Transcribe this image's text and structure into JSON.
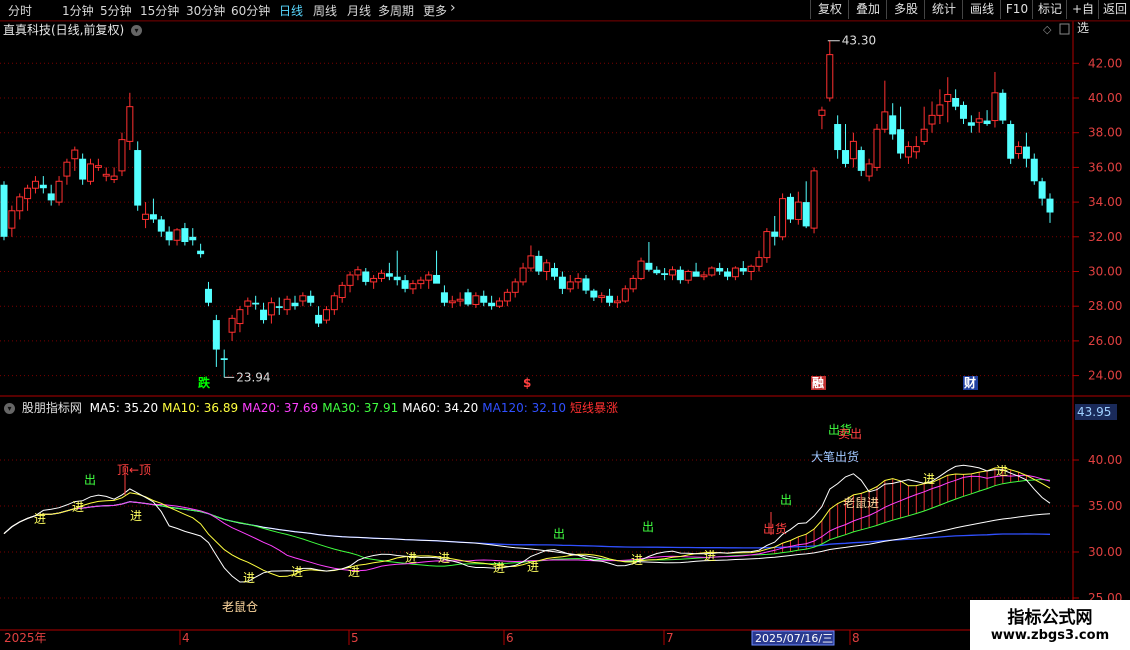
{
  "topbar": {
    "periods": [
      "分时",
      "1分钟",
      "5分钟",
      "15分钟",
      "30分钟",
      "60分钟",
      "日线",
      "周线",
      "月线",
      "多周期",
      "更多"
    ],
    "selected_period": "日线",
    "more_icon": "chevron-right-icon",
    "right_buttons": [
      "复权",
      "叠加",
      "多股",
      "统计",
      "画线",
      "F10",
      "标记",
      "+自选",
      "返回"
    ]
  },
  "chart_title": "直真科技(日线,前复权)",
  "main_chart": {
    "y_ticks": [
      "42.00",
      "40.00",
      "38.00",
      "36.00",
      "34.00",
      "32.00",
      "30.00",
      "28.00",
      "26.00",
      "24.00"
    ],
    "high_label": "43.30",
    "low_label": "23.94",
    "markers": [
      {
        "text": "跌",
        "color": "#00ff00"
      },
      {
        "text": "$",
        "color": "#ff4040"
      },
      {
        "text": "融",
        "color": "#ffffff",
        "bg": "#c03030"
      },
      {
        "text": "财",
        "color": "#ffffff",
        "bg": "#2040a0"
      }
    ]
  },
  "indicator": {
    "name": "股朋指标网",
    "ma": [
      {
        "label": "MA5: 35.20",
        "color": "#ffffff"
      },
      {
        "label": "MA10: 36.89",
        "color": "#ffff40"
      },
      {
        "label": "MA20: 37.69",
        "color": "#ff40ff"
      },
      {
        "label": "MA30: 37.91",
        "color": "#40ff40"
      },
      {
        "label": "MA60: 34.20",
        "color": "#ffffff"
      },
      {
        "label": "MA120: 32.10",
        "color": "#3050ff"
      },
      {
        "label": "短线暴涨",
        "color": "#ff3030"
      }
    ],
    "current_value": "43.95",
    "y_ticks": [
      "40.00",
      "35.00",
      "30.00",
      "25.00"
    ],
    "annotations": {
      "jin": "进",
      "chu": "出",
      "ding": "顶←顶",
      "laoshucang": "老鼠仓",
      "dabi": "大笔出货",
      "laoshujin": "老鼠进",
      "chuhuo": "出货",
      "maichu": "卖出"
    }
  },
  "timeline": {
    "labels": [
      "2025年",
      "4",
      "5",
      "6",
      "7",
      "8"
    ],
    "cursor_date": "2025/07/16/三"
  },
  "watermark": {
    "line1": "指标公式网",
    "line2": "www.zbgs3.com"
  },
  "chart_data": {
    "type": "candlestick",
    "title": "直真科技(日线,前复权)",
    "ylim": [
      23,
      43.5
    ],
    "x_labels": [
      "2025年",
      "4",
      "5",
      "6",
      "7",
      "8"
    ],
    "candles": [
      [
        35.0,
        35.2,
        31.8,
        32.0
      ],
      [
        32.5,
        33.8,
        32.0,
        33.5
      ],
      [
        33.5,
        34.5,
        33.0,
        34.3
      ],
      [
        34.2,
        35.0,
        33.5,
        34.8
      ],
      [
        34.8,
        35.5,
        34.5,
        35.2
      ],
      [
        35.0,
        35.5,
        34.5,
        34.8
      ],
      [
        34.5,
        35.0,
        33.8,
        34.1
      ],
      [
        34.0,
        35.5,
        33.8,
        35.2
      ],
      [
        35.5,
        36.5,
        35.0,
        36.3
      ],
      [
        36.5,
        37.2,
        35.8,
        37.0
      ],
      [
        36.5,
        36.8,
        35.0,
        35.3
      ],
      [
        35.2,
        36.5,
        35.0,
        36.2
      ],
      [
        36.0,
        36.5,
        35.8,
        36.1
      ],
      [
        35.5,
        36.0,
        35.2,
        35.6
      ],
      [
        35.3,
        36.0,
        35.1,
        35.5
      ],
      [
        35.8,
        38.0,
        35.5,
        37.6
      ],
      [
        37.5,
        40.3,
        37.0,
        39.5
      ],
      [
        37.0,
        37.5,
        33.5,
        33.8
      ],
      [
        33.0,
        34.0,
        32.5,
        33.3
      ],
      [
        33.3,
        34.2,
        32.8,
        33.0
      ],
      [
        33.0,
        33.2,
        32.0,
        32.3
      ],
      [
        32.3,
        32.6,
        31.5,
        31.8
      ],
      [
        31.8,
        32.5,
        31.5,
        32.4
      ],
      [
        32.5,
        32.8,
        31.5,
        31.7
      ],
      [
        32.0,
        32.5,
        31.5,
        31.8
      ],
      [
        31.2,
        31.6,
        30.8,
        31.0
      ],
      [
        29.0,
        29.4,
        28.0,
        28.2
      ],
      [
        27.2,
        27.5,
        24.5,
        25.5
      ],
      [
        25.0,
        25.5,
        23.9,
        24.9
      ],
      [
        26.5,
        27.5,
        26.0,
        27.3
      ],
      [
        27.0,
        28.0,
        26.5,
        27.8
      ],
      [
        28.0,
        28.5,
        27.5,
        28.3
      ],
      [
        28.2,
        28.6,
        27.8,
        28.1
      ],
      [
        27.8,
        28.2,
        27.0,
        27.2
      ],
      [
        27.5,
        28.5,
        27.0,
        28.2
      ],
      [
        28.0,
        28.5,
        27.5,
        27.9
      ],
      [
        27.8,
        28.6,
        27.5,
        28.4
      ],
      [
        28.2,
        28.6,
        27.8,
        28.0
      ],
      [
        28.3,
        28.8,
        28.0,
        28.6
      ],
      [
        28.6,
        28.9,
        28.0,
        28.2
      ],
      [
        27.5,
        28.0,
        26.8,
        27.0
      ],
      [
        27.2,
        28.0,
        27.0,
        27.8
      ],
      [
        27.8,
        28.8,
        27.5,
        28.6
      ],
      [
        28.5,
        29.4,
        28.2,
        29.2
      ],
      [
        29.2,
        30.0,
        28.8,
        29.8
      ],
      [
        29.8,
        30.3,
        29.5,
        30.1
      ],
      [
        30.0,
        30.2,
        29.2,
        29.4
      ],
      [
        29.4,
        29.8,
        29.0,
        29.6
      ],
      [
        29.6,
        30.1,
        29.4,
        29.9
      ],
      [
        29.9,
        30.5,
        29.5,
        29.7
      ],
      [
        29.7,
        31.2,
        29.2,
        29.5
      ],
      [
        29.5,
        29.8,
        28.8,
        29.0
      ],
      [
        29.0,
        29.5,
        28.7,
        29.3
      ],
      [
        29.3,
        29.7,
        29.0,
        29.5
      ],
      [
        29.5,
        30.0,
        29.0,
        29.8
      ],
      [
        29.8,
        31.2,
        29.5,
        29.3
      ],
      [
        28.8,
        29.2,
        28.0,
        28.2
      ],
      [
        28.2,
        28.6,
        27.9,
        28.3
      ],
      [
        28.3,
        28.8,
        28.0,
        28.4
      ],
      [
        28.8,
        29.0,
        28.0,
        28.1
      ],
      [
        28.1,
        28.8,
        27.9,
        28.6
      ],
      [
        28.6,
        28.9,
        28.0,
        28.2
      ],
      [
        28.2,
        28.6,
        27.8,
        28.0
      ],
      [
        28.0,
        28.5,
        27.9,
        28.3
      ],
      [
        28.3,
        29.0,
        28.0,
        28.8
      ],
      [
        28.8,
        29.6,
        28.5,
        29.4
      ],
      [
        29.4,
        30.5,
        29.2,
        30.2
      ],
      [
        30.2,
        31.5,
        30.0,
        30.9
      ],
      [
        30.9,
        31.2,
        29.8,
        30.0
      ],
      [
        30.0,
        30.7,
        29.5,
        30.5
      ],
      [
        30.2,
        30.5,
        29.5,
        29.7
      ],
      [
        29.7,
        30.0,
        28.7,
        29.0
      ],
      [
        29.0,
        29.8,
        28.8,
        29.4
      ],
      [
        29.4,
        29.9,
        29.0,
        29.6
      ],
      [
        29.6,
        29.8,
        28.7,
        28.9
      ],
      [
        28.9,
        29.0,
        28.3,
        28.5
      ],
      [
        28.5,
        28.8,
        28.2,
        28.6
      ],
      [
        28.6,
        29.0,
        28.0,
        28.2
      ],
      [
        28.2,
        28.6,
        27.9,
        28.3
      ],
      [
        28.3,
        29.2,
        28.2,
        29.0
      ],
      [
        29.0,
        29.8,
        28.8,
        29.6
      ],
      [
        29.6,
        30.8,
        29.5,
        30.6
      ],
      [
        30.5,
        31.7,
        30.0,
        30.1
      ],
      [
        30.1,
        30.3,
        29.8,
        29.9
      ],
      [
        29.9,
        30.2,
        29.5,
        29.8
      ],
      [
        29.8,
        30.3,
        29.5,
        30.1
      ],
      [
        30.1,
        30.3,
        29.3,
        29.5
      ],
      [
        29.5,
        30.1,
        29.3,
        30.0
      ],
      [
        30.0,
        30.5,
        29.8,
        29.7
      ],
      [
        29.7,
        30.0,
        29.5,
        29.8
      ],
      [
        29.8,
        30.3,
        29.7,
        30.2
      ],
      [
        30.2,
        30.5,
        29.8,
        30.0
      ],
      [
        30.0,
        30.2,
        29.5,
        29.7
      ],
      [
        29.7,
        30.3,
        29.5,
        30.2
      ],
      [
        30.2,
        30.6,
        29.8,
        30.0
      ],
      [
        30.0,
        30.4,
        29.5,
        30.3
      ],
      [
        30.3,
        31.2,
        30.0,
        30.8
      ],
      [
        30.8,
        32.5,
        30.5,
        32.3
      ],
      [
        32.3,
        33.2,
        31.5,
        32.0
      ],
      [
        32.0,
        34.5,
        31.8,
        34.2
      ],
      [
        34.3,
        34.5,
        32.8,
        33.0
      ],
      [
        33.0,
        34.6,
        32.7,
        34.0
      ],
      [
        34.0,
        35.2,
        32.5,
        32.6
      ],
      [
        32.5,
        36.0,
        32.2,
        35.8
      ],
      [
        39.0,
        39.5,
        38.2,
        39.3
      ],
      [
        40.0,
        43.3,
        39.8,
        42.5
      ],
      [
        38.5,
        39.0,
        36.5,
        37.0
      ],
      [
        37.0,
        38.5,
        36.0,
        36.2
      ],
      [
        36.5,
        38.0,
        36.0,
        37.5
      ],
      [
        37.0,
        37.2,
        35.5,
        35.8
      ],
      [
        35.5,
        36.5,
        35.2,
        36.2
      ],
      [
        36.0,
        38.5,
        35.8,
        38.2
      ],
      [
        38.2,
        41.0,
        38.0,
        39.2
      ],
      [
        39.0,
        39.7,
        37.6,
        37.9
      ],
      [
        38.2,
        39.5,
        36.5,
        36.8
      ],
      [
        36.6,
        37.5,
        36.2,
        37.2
      ],
      [
        36.9,
        37.8,
        36.5,
        37.2
      ],
      [
        37.5,
        39.5,
        37.3,
        38.2
      ],
      [
        38.5,
        39.8,
        38.0,
        39.0
      ],
      [
        39.0,
        40.5,
        38.5,
        39.6
      ],
      [
        39.8,
        41.2,
        38.6,
        40.2
      ],
      [
        40.0,
        40.5,
        39.3,
        39.5
      ],
      [
        39.6,
        39.8,
        38.5,
        38.8
      ],
      [
        38.6,
        39.0,
        38.0,
        38.4
      ],
      [
        38.6,
        39.2,
        38.0,
        38.8
      ],
      [
        38.7,
        39.3,
        38.4,
        38.5
      ],
      [
        38.7,
        41.5,
        38.3,
        40.3
      ],
      [
        40.3,
        40.5,
        38.5,
        38.7
      ],
      [
        38.5,
        38.7,
        36.2,
        36.5
      ],
      [
        36.8,
        37.5,
        36.5,
        37.2
      ],
      [
        37.2,
        38.0,
        36.0,
        36.5
      ],
      [
        36.5,
        36.8,
        35.0,
        35.2
      ],
      [
        35.2,
        35.4,
        33.8,
        34.2
      ],
      [
        34.2,
        34.5,
        32.8,
        33.4
      ]
    ]
  }
}
